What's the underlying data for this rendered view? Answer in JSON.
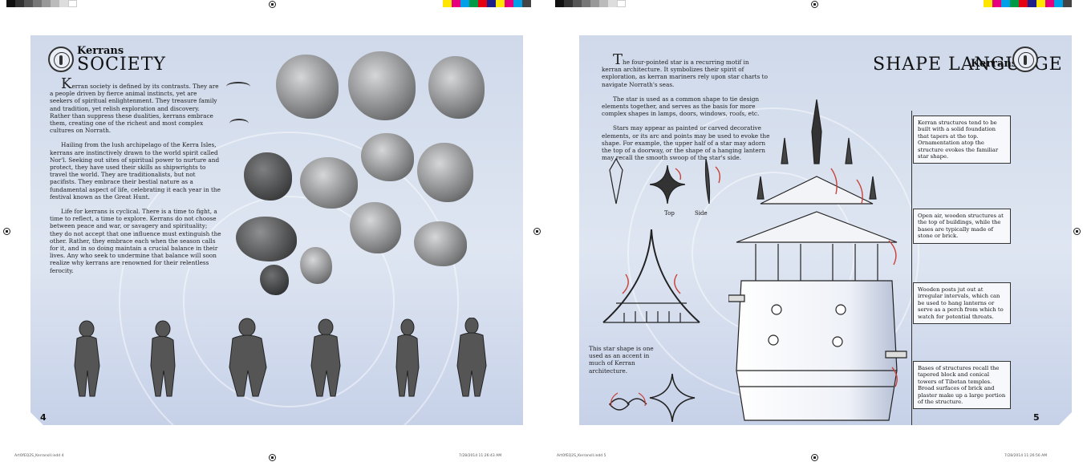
{
  "left_page": {
    "kicker": "Kerrans",
    "title": "SOCIETY",
    "paragraphs": [
      "Kerran society is defined by its contrasts. They are a people driven by fierce animal instincts, yet are seekers of spiritual enlightenment. They treasure family and tradition, yet relish exploration and discovery. Rather than suppress these dualities, kerrans embrace them, creating one of the richest and most complex cultures on Norrath.",
      "Hailing from the lush archipelago of the Kerra Isles, kerrans are instinctively drawn to the world spirit called Nor'l. Seeking out sites of spiritual power to nurture and protect, they have used their skills as shipwrights to travel the world. They are traditionalists, but not pacifists. They embrace their bestial nature as a fundamental aspect of life, celebrating it each year in the festival known as the Great Hunt.",
      "Life for kerrans is cyclical. There is a time to fight, a time to reflect, a time to explore. Kerrans do not choose between peace and war, or savagery and spirituality; they do not accept that one influence must extinguish the other. Rather, they embrace each when the season calls for it, and in so doing maintain a crucial balance in their lives. Any who seek to undermine that balance will soon realize why kerrans are renowned for their relentless ferocity."
    ],
    "page_number": "4"
  },
  "right_page": {
    "kicker": "Kerrans",
    "title": "SHAPE LANGUAGE",
    "paragraphs": [
      "The four-pointed star is a recurring motif in kerran architecture. It symbolizes their spirit of exploration, as kerran mariners rely upon star charts to navigate Norrath's seas.",
      "The star is used as a common shape to tie design elements together, and serves as the basis for more complex shapes in lamps, doors, windows, roofs, etc.",
      "Stars may appear as painted or carved decorative elements, or its arc and points may be used to evoke the shape. For example, the upper half of a star may adorn the top of a doorway, or the shape of a hanging lantern may recall the smooth swoop of the star's side."
    ],
    "label_top": "Top",
    "label_side": "Side",
    "star_caption": "This star shape is one used as an accent in much of Kerran architecture.",
    "callouts": [
      "Kerran structures tend to be built with a solid foundation that tapers at the top. Ornamentation atop the structure evokes the familiar star shape.",
      "Open air, wooden structures at the top of buildings, while the bases are typically made of stone or brick.",
      "Wooden posts jut out at irregular intervals, which can be used to hang lanterns or serve as a perch from which to watch for potential threats.",
      "Bases of structures recall the tapered block and conical towers of Tibetan temples. Broad surfaces of brick and plaster make up a large portion of the structure."
    ],
    "page_number": "5"
  },
  "slug": {
    "left_file": "ArtOfEQ2S_KerransII.indd   4",
    "left_date": "7/28/2014   11:26:43 AM",
    "right_file": "ArtOfEQ2S_KerransII.indd   5",
    "right_date": "7/28/2014   11:26:56 AM"
  },
  "colors": {
    "page_bg": "#cfd9ea",
    "ink": "#111111",
    "accent_red": "#c8423a"
  }
}
